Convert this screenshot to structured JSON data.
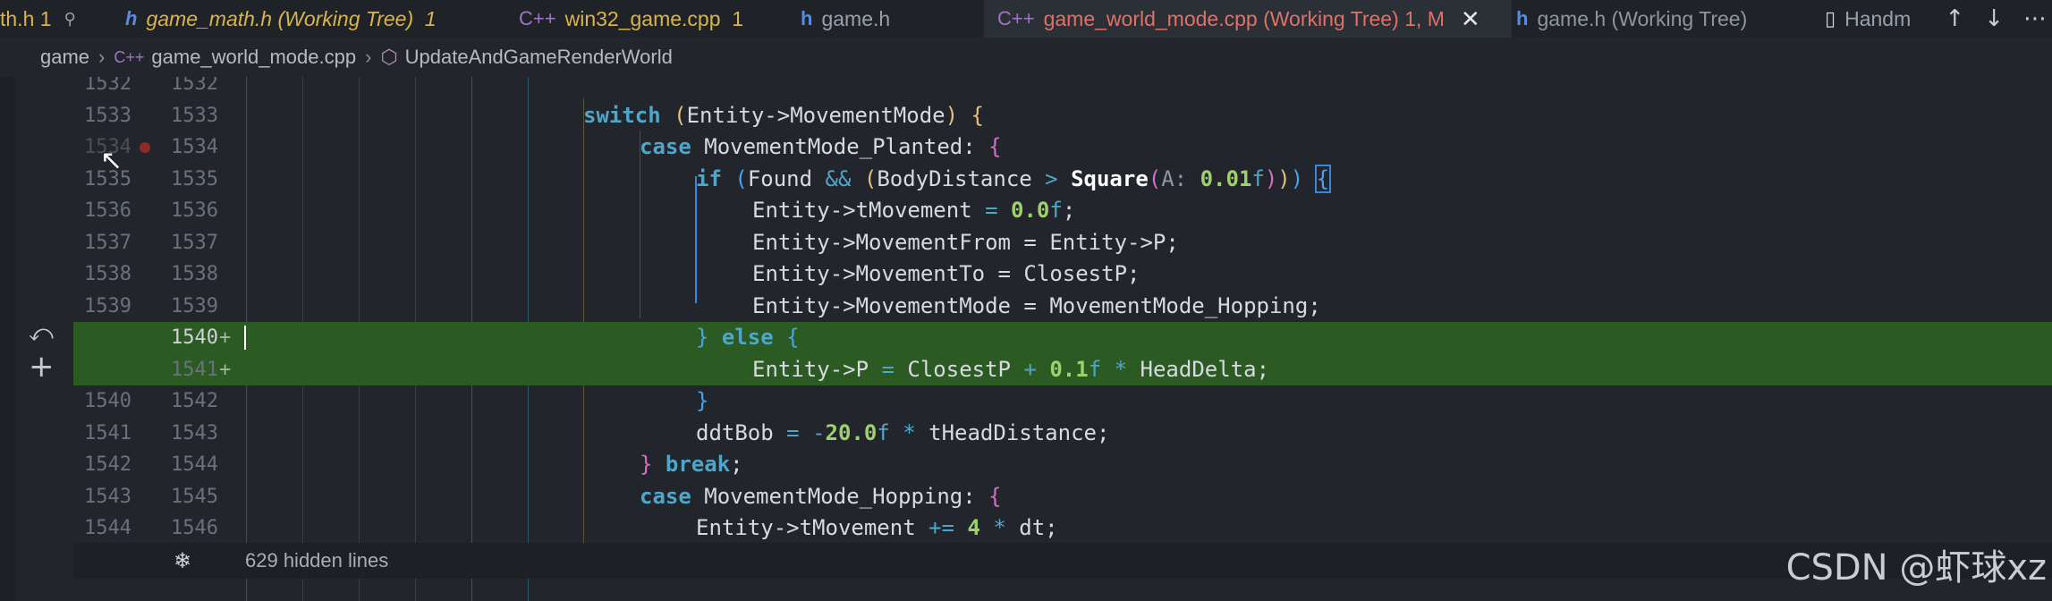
{
  "tabs": [
    {
      "label": "th.h",
      "suffix": "1",
      "icon": "pin-icon",
      "state": "modified"
    },
    {
      "label": "game_math.h (Working Tree)",
      "suffix": "1",
      "icon": "header-file-icon",
      "state": "modified"
    },
    {
      "label": "win32_game.cpp",
      "suffix": "1",
      "icon": "cpp-file-icon",
      "state": "modified"
    },
    {
      "label": "game.h",
      "suffix": "",
      "icon": "header-file-icon",
      "state": "normal"
    },
    {
      "label": "game_world_mode.cpp (Working Tree)",
      "suffix": "1, M",
      "icon": "cpp-file-icon",
      "state": "active"
    },
    {
      "label": "game.h (Working Tree)",
      "suffix": "",
      "icon": "header-file-icon",
      "state": "normal"
    },
    {
      "label": "Handm",
      "suffix": "",
      "icon": "file-icon",
      "state": "normal"
    }
  ],
  "tab_close_glyph": "✕",
  "breadcrumb": {
    "folder": "game",
    "file": "game_world_mode.cpp",
    "symbol": "UpdateAndGameRenderWorld"
  },
  "lines": [
    {
      "a": "1532",
      "b": "1532",
      "added": false
    },
    {
      "a": "1533",
      "b": "1533",
      "added": false
    },
    {
      "a": "1534",
      "b": "1534",
      "added": false
    },
    {
      "a": "1535",
      "b": "1535",
      "added": false
    },
    {
      "a": "1536",
      "b": "1536",
      "added": false
    },
    {
      "a": "1537",
      "b": "1537",
      "added": false
    },
    {
      "a": "1538",
      "b": "1538",
      "added": false
    },
    {
      "a": "1539",
      "b": "1539",
      "added": false
    },
    {
      "a": "",
      "b": "1540",
      "added": true
    },
    {
      "a": "",
      "b": "1541",
      "added": true
    },
    {
      "a": "1540",
      "b": "1542",
      "added": false
    },
    {
      "a": "1541",
      "b": "1543",
      "added": false
    },
    {
      "a": "1542",
      "b": "1544",
      "added": false
    },
    {
      "a": "1543",
      "b": "1545",
      "added": false
    },
    {
      "a": "1544",
      "b": "1546",
      "added": false
    }
  ],
  "code": {
    "l1533": {
      "kw": "switch",
      "open": "(",
      "expr": "Entity->MovementMode",
      "close": ")",
      "brace": "{"
    },
    "l1534": {
      "kw": "case",
      "label": "MovementMode_Planted:",
      "brace": "{"
    },
    "l1535": {
      "kw": "if",
      "p_open": "(",
      "found": "Found",
      "and": "&&",
      "p2_open": "(",
      "body": "BodyDistance",
      "gt": ">",
      "fn": "Square",
      "p3_open": "(",
      "hint": "A:",
      "num": "0.01",
      "suffix": "f",
      "p3_close": ")",
      "p2_close": ")",
      "p_close": ")",
      "brace": "{"
    },
    "l1536": {
      "lhs": "Entity->tMovement",
      "eq": "=",
      "num": "0.0",
      "suffix": "f",
      "semi": ";"
    },
    "l1537": {
      "text": "Entity->MovementFrom = Entity->P;"
    },
    "l1538": {
      "text": "Entity->MovementTo = ClosestP;"
    },
    "l1539": {
      "text": "Entity->MovementMode = MovementMode_Hopping;"
    },
    "l1540": {
      "close": "}",
      "kw": "else",
      "brace": "{"
    },
    "l1541": {
      "lhs": "Entity->P",
      "eq": "=",
      "mid": "ClosestP",
      "plus": "+",
      "num": "0.1",
      "suffix": "f",
      "star": "*",
      "rhs": "HeadDelta;"
    },
    "l1542": {
      "close": "}"
    },
    "l1543": {
      "lhs": "ddtBob",
      "eq": "=",
      "minus": "-",
      "num": "20.0",
      "suffix": "f",
      "star": "*",
      "rhs": "tHeadDistance;"
    },
    "l1544": {
      "close": "}",
      "kw": "break",
      "semi": ";"
    },
    "l1545": {
      "kw": "case",
      "label": "MovementMode_Hopping:",
      "brace": "{"
    },
    "l1546": {
      "lhs": "Entity->tMovement",
      "op": "+=",
      "num": "4",
      "star": "*",
      "rhs": "dt;"
    }
  },
  "hidden_lines": {
    "icon": "unfold-icon",
    "label": "629 hidden lines"
  },
  "margin_actions": {
    "revert_glyph": "⤺",
    "stage_glyph": "+"
  },
  "watermark": "CSDN @虾球xz",
  "colors": {
    "added_bg": "#2b5a22",
    "active_tab_text": "#e07167",
    "modified_tab_text": "#d9b44a"
  }
}
